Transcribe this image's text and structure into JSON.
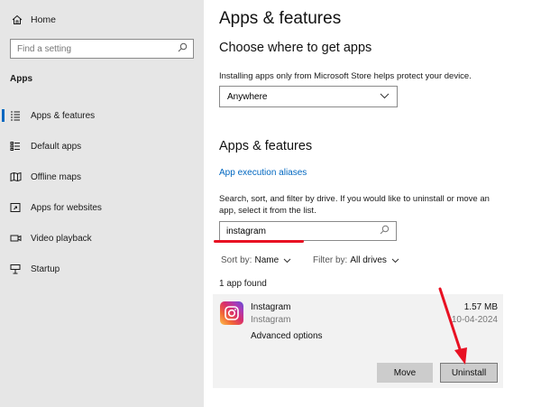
{
  "sidebar": {
    "home_label": "Home",
    "search_placeholder": "Find a setting",
    "section_label": "Apps",
    "items": [
      {
        "label": "Apps & features",
        "icon": "list-icon",
        "active": true
      },
      {
        "label": "Default apps",
        "icon": "default-apps-icon"
      },
      {
        "label": "Offline maps",
        "icon": "map-icon"
      },
      {
        "label": "Apps for websites",
        "icon": "open-in-app-icon"
      },
      {
        "label": "Video playback",
        "icon": "video-icon"
      },
      {
        "label": "Startup",
        "icon": "startup-icon"
      }
    ]
  },
  "main": {
    "title": "Apps & features",
    "source": {
      "heading": "Choose where to get apps",
      "description": "Installing apps only from Microsoft Store helps protect your device.",
      "selected": "Anywhere"
    },
    "features": {
      "heading": "Apps & features",
      "aliases_link": "App execution aliases",
      "instructions_line1": "Search, sort, and filter by drive. If you would like to uninstall or move an",
      "instructions_line2": "app, select it from the list.",
      "search_value": "instagram",
      "sort_label": "Sort by:",
      "sort_value": "Name",
      "filter_label": "Filter by:",
      "filter_value": "All drives",
      "result_count": "1 app found"
    },
    "app": {
      "name": "Instagram",
      "publisher": "Instagram",
      "size": "1.57 MB",
      "date": "10-04-2024",
      "advanced_label": "Advanced options",
      "move_label": "Move",
      "uninstall_label": "Uninstall"
    }
  },
  "colors": {
    "accent": "#0067c0",
    "annotation": "#e81123",
    "sidebar_bg": "#e6e6e6",
    "card_bg": "#f2f2f2"
  }
}
